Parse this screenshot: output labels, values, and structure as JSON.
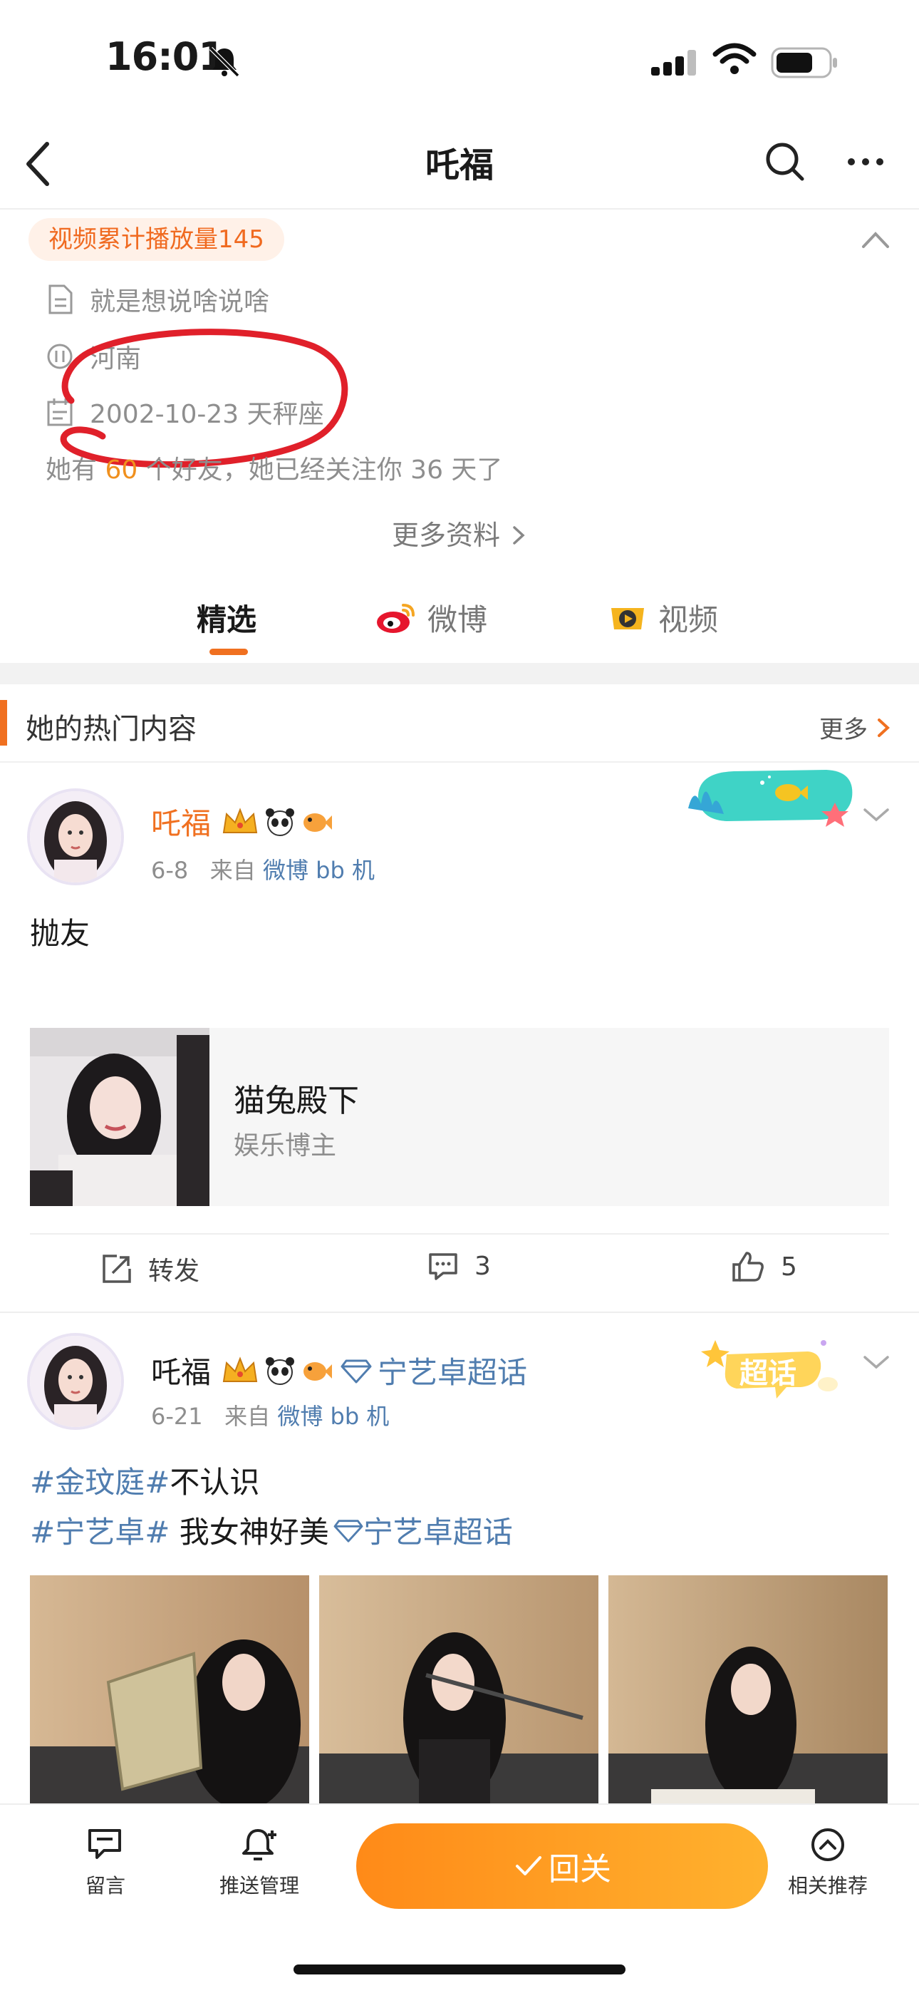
{
  "status_bar": {
    "time": "16:01"
  },
  "nav": {
    "title": "吒福"
  },
  "profile": {
    "play_badge": "视频累计播放量145",
    "bio": "就是想说啥说啥",
    "location": "河南",
    "birthday": "2002-10-23 天秤座",
    "friends_prefix": "她有",
    "friends_count": "60",
    "friends_suffix": "个好友，她已经关注你 36 天了",
    "more_info": "更多资料"
  },
  "tabs": [
    {
      "label": "精选",
      "active": true
    },
    {
      "label": "微博",
      "active": false
    },
    {
      "label": "视频",
      "active": false
    }
  ],
  "hot_section": {
    "title": "她的热门内容",
    "more": "更多"
  },
  "posts": [
    {
      "author": "吒福",
      "date": "6-8",
      "source_prefix": "来自",
      "source": "微博 bb 机",
      "text": "抛友",
      "card": {
        "title": "猫兔殿下",
        "subtitle": "娱乐博主"
      },
      "actions": {
        "repost": "转发",
        "comments": "3",
        "likes": "5"
      }
    },
    {
      "author": "吒福",
      "topic": "宁艺卓超话",
      "date": "6-21",
      "source_prefix": "来自",
      "source": "微博 bb 机",
      "line1_tag": "#金玟庭#",
      "line1_text": "不认识",
      "line2_tag": "#宁艺卓#",
      "line2_text": " 我女神好美",
      "line2_topic": "宁艺卓超话",
      "badge": "超话"
    }
  ],
  "bottom_bar": {
    "message": "留言",
    "push": "推送管理",
    "follow": "回关",
    "related": "相关推荐"
  },
  "colors": {
    "accent": "#f07020",
    "link": "#507daf",
    "badge_bg": "#fff1e8"
  }
}
